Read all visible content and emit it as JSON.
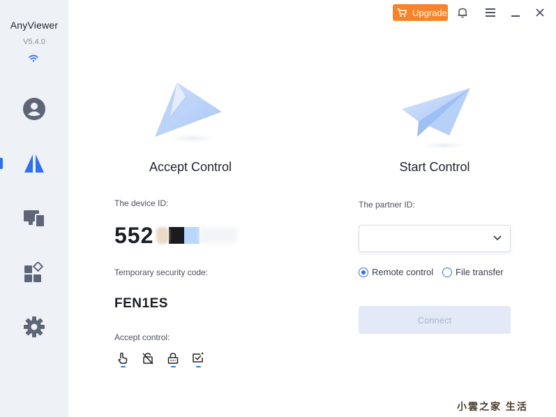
{
  "app": {
    "name": "AnyViewer",
    "version": "V5.4.0"
  },
  "sidebar": {
    "items": [
      {
        "name": "account",
        "icon": "user-icon"
      },
      {
        "name": "remote",
        "icon": "remote-control-icon",
        "active": true
      },
      {
        "name": "devices",
        "icon": "devices-icon"
      },
      {
        "name": "tools",
        "icon": "tools-icon"
      },
      {
        "name": "settings",
        "icon": "gear-icon"
      }
    ]
  },
  "topbar": {
    "upgrade_label": "Upgrade"
  },
  "accept": {
    "title": "Accept Control",
    "device_id_label": "The device ID:",
    "device_id_visible": "552",
    "security_label": "Temporary security code:",
    "security_code": "FEN1ES",
    "accept_label": "Accept control:"
  },
  "start": {
    "title": "Start Control",
    "partner_label": "The partner ID:",
    "partner_value": "",
    "options": [
      {
        "label": "Remote control",
        "checked": true
      },
      {
        "label": "File transfer",
        "checked": false
      }
    ],
    "connect_label": "Connect"
  },
  "watermark": {
    "text": "小雲之家 生活"
  },
  "colors": {
    "accent": "#2f6fed",
    "upgrade": "#f7842a",
    "sidebar_bg": "#eef1f6",
    "icon": "#5d6577"
  }
}
